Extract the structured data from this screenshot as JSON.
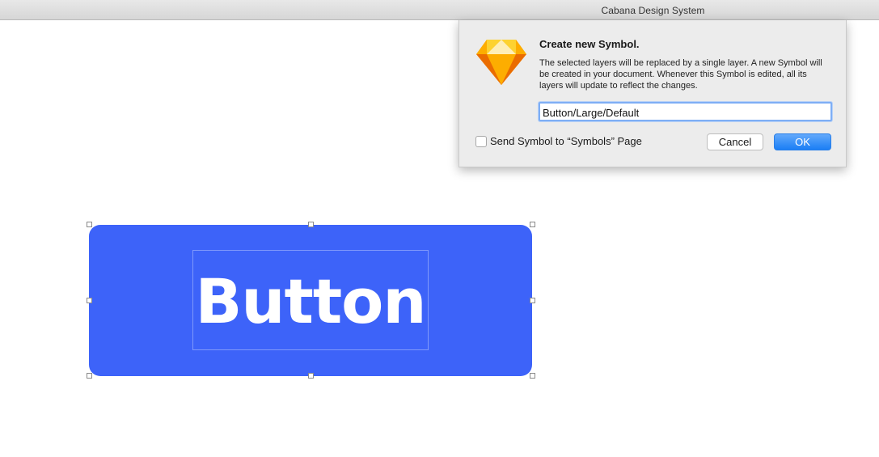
{
  "window": {
    "title": "Cabana Design System"
  },
  "canvas": {
    "button_element": {
      "label": "Button",
      "fill_color": "#3d63f9"
    }
  },
  "dialog": {
    "icon": "sketch-diamond-icon",
    "title": "Create new Symbol.",
    "body": "The selected layers will be replaced by a single layer. A new Symbol will be created in your document. Whenever this Symbol is edited, all its layers will update to reflect the changes.",
    "symbol_name_value": "Button/Large/Default",
    "send_to_symbols_page": {
      "label": "Send Symbol to “Symbols” Page",
      "checked": false
    },
    "cancel_label": "Cancel",
    "ok_label": "OK"
  },
  "colors": {
    "accent": "#1a7ef5",
    "selection_handle_border": "#8a8a8a"
  }
}
